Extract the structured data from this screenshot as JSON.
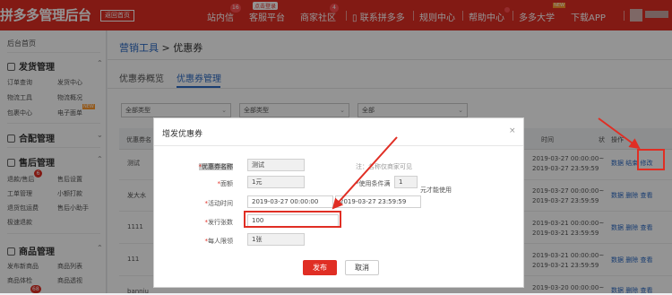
{
  "header": {
    "logo": "拼多多管理后台",
    "home_button": "返回首页",
    "nav": [
      {
        "label": "站内信",
        "badge": "16"
      },
      {
        "label": "客服平台",
        "flag": "点击登录"
      },
      {
        "label": "商家社区",
        "badge": "4"
      },
      {
        "label": "联系拼多多"
      },
      {
        "label": "规则中心"
      },
      {
        "label": "帮助中心"
      },
      {
        "label": "多多大学",
        "tag": "NEW"
      },
      {
        "label": "下载APP"
      }
    ]
  },
  "sidebar": {
    "home": "后台首页",
    "sections": [
      {
        "title": "发货管理",
        "items": [
          "订单查询",
          "发货中心",
          "物流工具",
          "物流概况",
          "包裹中心",
          "电子面单"
        ],
        "item_badge": "NEW"
      },
      {
        "title": "合配管理"
      },
      {
        "title": "售后管理",
        "items": [
          "退款/售后",
          "售后设置",
          "工单管理",
          "小额打款",
          "退货包运费",
          "售后小助手",
          "极速退款"
        ],
        "item_badge": "6"
      },
      {
        "title": "商品管理",
        "items": [
          "发布新商品",
          "商品列表",
          "商品体检",
          "商品透视"
        ],
        "item_badge": "68"
      }
    ]
  },
  "main": {
    "breadcrumb": {
      "parent": "营销工具",
      "sep": ">",
      "current": "优惠券"
    },
    "tabs": [
      "优惠券概览",
      "优惠券管理"
    ],
    "active_tab": "优惠券管理",
    "filters": [
      "全部类型",
      "全部类型",
      "全部"
    ],
    "table": {
      "headers": [
        "优惠券名",
        "时间",
        "状",
        "操作"
      ],
      "rows": [
        {
          "name": "测试",
          "time_start": "2019-03-27 00:00:00~",
          "time_end": "2019-03-27 23:59:59",
          "actions": [
            "数据",
            "结束",
            "修改"
          ]
        },
        {
          "name": "发大水",
          "time_start": "2019-03-27 00:00:00~",
          "time_end": "2019-03-27 23:59:59",
          "actions": [
            "数据",
            "删除",
            "查看"
          ]
        },
        {
          "name": "1111",
          "time_start": "2019-03-21 00:00:00~",
          "time_end": "2019-03-21 23:59:59",
          "actions": [
            "数据",
            "删除",
            "查看"
          ]
        },
        {
          "name": "111",
          "time_start": "2019-03-21 00:00:00~",
          "time_end": "2019-03-21 23:59:59",
          "actions": [
            "数据",
            "删除",
            "查看"
          ]
        },
        {
          "name": "banniu",
          "time_start": "2019-03-20 00:00:00~",
          "time_end": "",
          "actions": [
            "数据",
            "删除",
            "查看"
          ]
        }
      ]
    }
  },
  "modal": {
    "title": "增发优惠券",
    "close": "×",
    "fields": {
      "name_label": "优惠券名称",
      "name_value": "测试",
      "name_note": "注：名称仅商家可见",
      "amount_label": "面额",
      "amount_value": "1元",
      "condition_label": "*使用条件满",
      "condition_value": "1",
      "condition_suffix": "元才能使用",
      "time_label": "活动时间",
      "time_start": "2019-03-27 00:00:00",
      "time_end": "2019-03-27 23:59:59",
      "count_label": "发行张数",
      "count_value": "100",
      "limit_label": "每人限领",
      "limit_value": "1张"
    },
    "publish": "发布",
    "cancel": "取消"
  },
  "colors": {
    "brand": "#e02e24",
    "link": "#2d6bc4"
  }
}
